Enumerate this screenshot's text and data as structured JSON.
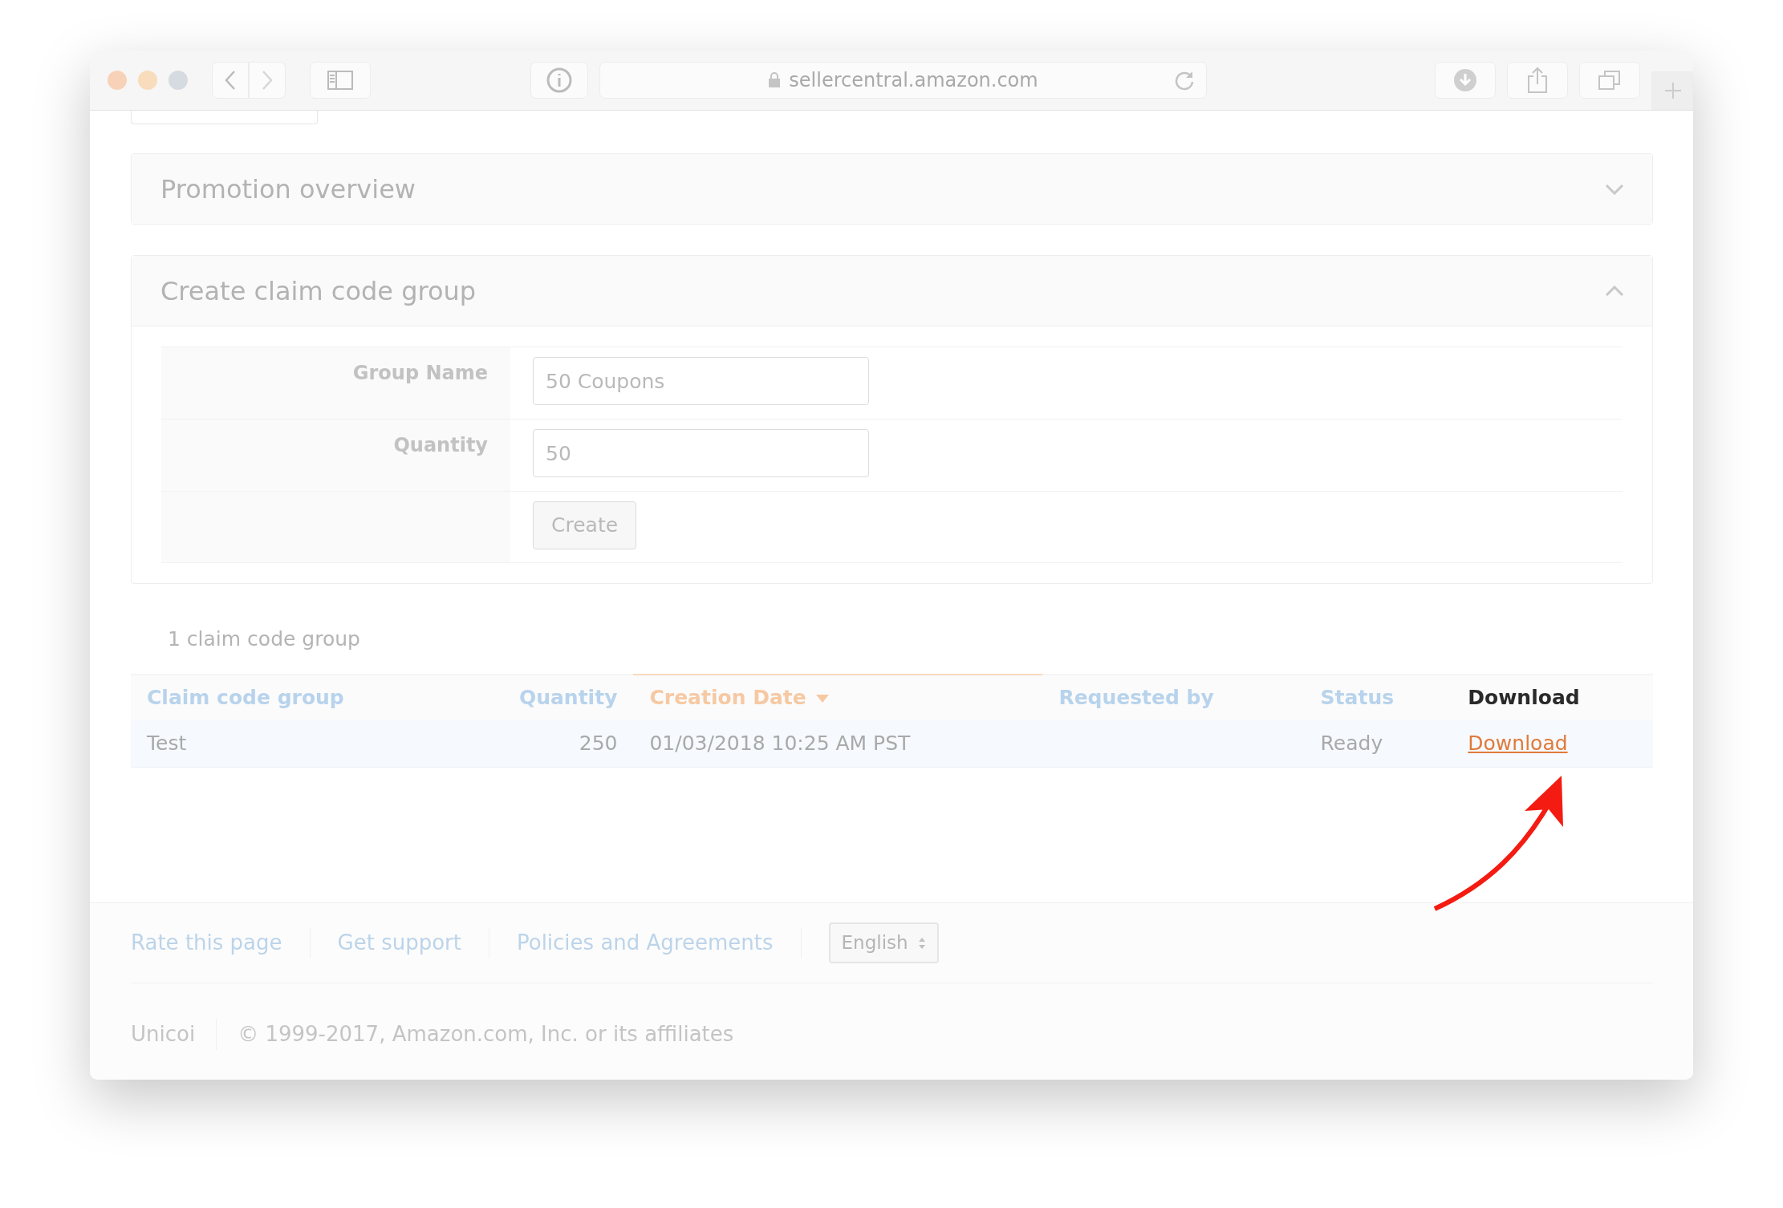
{
  "browser": {
    "url": "sellercentral.amazon.com"
  },
  "panels": [
    {
      "title": "Promotion overview",
      "expanded": false
    },
    {
      "title": "Create claim code group",
      "expanded": true,
      "fields": [
        {
          "label": "Group Name",
          "value": "50 Coupons"
        },
        {
          "label": "Quantity",
          "value": "50"
        }
      ],
      "button": "Create"
    }
  ],
  "summary": "1 claim code group",
  "table": {
    "columns": [
      {
        "label": "Claim code group",
        "sortable": true,
        "sorted": false,
        "kind": "text"
      },
      {
        "label": "Quantity",
        "sortable": true,
        "sorted": false,
        "kind": "number"
      },
      {
        "label": "Creation Date",
        "sortable": true,
        "sorted": true,
        "kind": "text"
      },
      {
        "label": "Requested by",
        "sortable": true,
        "sorted": false,
        "kind": "text"
      },
      {
        "label": "Status",
        "sortable": true,
        "sorted": false,
        "kind": "text"
      },
      {
        "label": "Download",
        "sortable": false,
        "sorted": false,
        "kind": "link"
      }
    ],
    "rows": [
      {
        "cells": [
          "Test",
          "250",
          "01/03/2018 10:25 AM PST",
          null,
          "Ready",
          "Download"
        ]
      }
    ]
  },
  "footer": {
    "links": [
      "Rate this page",
      "Get support",
      "Policies and Agreements"
    ],
    "language": "English",
    "company": "Unicoi",
    "copyright": "© 1999-2017, Amazon.com, Inc. or its affiliates"
  }
}
